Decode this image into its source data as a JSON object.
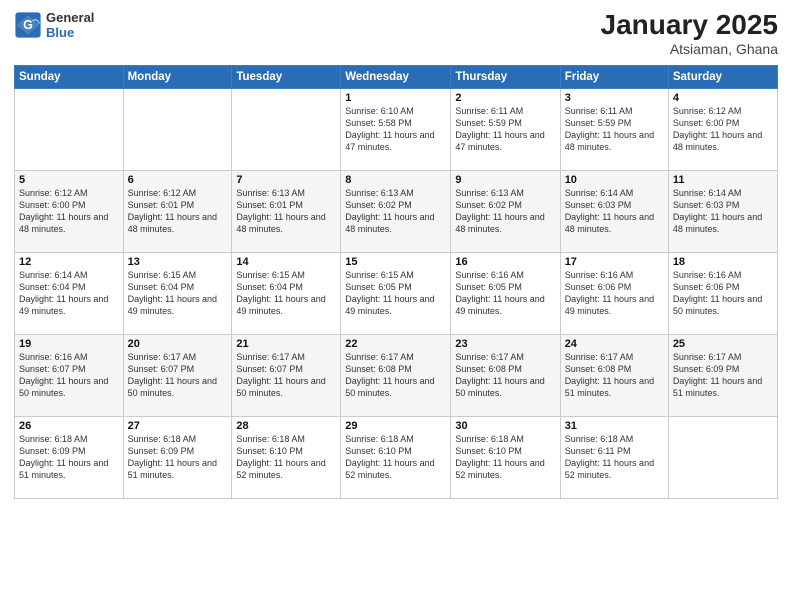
{
  "header": {
    "logo_general": "General",
    "logo_blue": "Blue",
    "month_title": "January 2025",
    "location": "Atsiaman, Ghana"
  },
  "days_of_week": [
    "Sunday",
    "Monday",
    "Tuesday",
    "Wednesday",
    "Thursday",
    "Friday",
    "Saturday"
  ],
  "weeks": [
    [
      {
        "day": "",
        "info": ""
      },
      {
        "day": "",
        "info": ""
      },
      {
        "day": "",
        "info": ""
      },
      {
        "day": "1",
        "info": "Sunrise: 6:10 AM\nSunset: 5:58 PM\nDaylight: 11 hours and 47 minutes."
      },
      {
        "day": "2",
        "info": "Sunrise: 6:11 AM\nSunset: 5:59 PM\nDaylight: 11 hours and 47 minutes."
      },
      {
        "day": "3",
        "info": "Sunrise: 6:11 AM\nSunset: 5:59 PM\nDaylight: 11 hours and 48 minutes."
      },
      {
        "day": "4",
        "info": "Sunrise: 6:12 AM\nSunset: 6:00 PM\nDaylight: 11 hours and 48 minutes."
      }
    ],
    [
      {
        "day": "5",
        "info": "Sunrise: 6:12 AM\nSunset: 6:00 PM\nDaylight: 11 hours and 48 minutes."
      },
      {
        "day": "6",
        "info": "Sunrise: 6:12 AM\nSunset: 6:01 PM\nDaylight: 11 hours and 48 minutes."
      },
      {
        "day": "7",
        "info": "Sunrise: 6:13 AM\nSunset: 6:01 PM\nDaylight: 11 hours and 48 minutes."
      },
      {
        "day": "8",
        "info": "Sunrise: 6:13 AM\nSunset: 6:02 PM\nDaylight: 11 hours and 48 minutes."
      },
      {
        "day": "9",
        "info": "Sunrise: 6:13 AM\nSunset: 6:02 PM\nDaylight: 11 hours and 48 minutes."
      },
      {
        "day": "10",
        "info": "Sunrise: 6:14 AM\nSunset: 6:03 PM\nDaylight: 11 hours and 48 minutes."
      },
      {
        "day": "11",
        "info": "Sunrise: 6:14 AM\nSunset: 6:03 PM\nDaylight: 11 hours and 48 minutes."
      }
    ],
    [
      {
        "day": "12",
        "info": "Sunrise: 6:14 AM\nSunset: 6:04 PM\nDaylight: 11 hours and 49 minutes."
      },
      {
        "day": "13",
        "info": "Sunrise: 6:15 AM\nSunset: 6:04 PM\nDaylight: 11 hours and 49 minutes."
      },
      {
        "day": "14",
        "info": "Sunrise: 6:15 AM\nSunset: 6:04 PM\nDaylight: 11 hours and 49 minutes."
      },
      {
        "day": "15",
        "info": "Sunrise: 6:15 AM\nSunset: 6:05 PM\nDaylight: 11 hours and 49 minutes."
      },
      {
        "day": "16",
        "info": "Sunrise: 6:16 AM\nSunset: 6:05 PM\nDaylight: 11 hours and 49 minutes."
      },
      {
        "day": "17",
        "info": "Sunrise: 6:16 AM\nSunset: 6:06 PM\nDaylight: 11 hours and 49 minutes."
      },
      {
        "day": "18",
        "info": "Sunrise: 6:16 AM\nSunset: 6:06 PM\nDaylight: 11 hours and 50 minutes."
      }
    ],
    [
      {
        "day": "19",
        "info": "Sunrise: 6:16 AM\nSunset: 6:07 PM\nDaylight: 11 hours and 50 minutes."
      },
      {
        "day": "20",
        "info": "Sunrise: 6:17 AM\nSunset: 6:07 PM\nDaylight: 11 hours and 50 minutes."
      },
      {
        "day": "21",
        "info": "Sunrise: 6:17 AM\nSunset: 6:07 PM\nDaylight: 11 hours and 50 minutes."
      },
      {
        "day": "22",
        "info": "Sunrise: 6:17 AM\nSunset: 6:08 PM\nDaylight: 11 hours and 50 minutes."
      },
      {
        "day": "23",
        "info": "Sunrise: 6:17 AM\nSunset: 6:08 PM\nDaylight: 11 hours and 50 minutes."
      },
      {
        "day": "24",
        "info": "Sunrise: 6:17 AM\nSunset: 6:08 PM\nDaylight: 11 hours and 51 minutes."
      },
      {
        "day": "25",
        "info": "Sunrise: 6:17 AM\nSunset: 6:09 PM\nDaylight: 11 hours and 51 minutes."
      }
    ],
    [
      {
        "day": "26",
        "info": "Sunrise: 6:18 AM\nSunset: 6:09 PM\nDaylight: 11 hours and 51 minutes."
      },
      {
        "day": "27",
        "info": "Sunrise: 6:18 AM\nSunset: 6:09 PM\nDaylight: 11 hours and 51 minutes."
      },
      {
        "day": "28",
        "info": "Sunrise: 6:18 AM\nSunset: 6:10 PM\nDaylight: 11 hours and 52 minutes."
      },
      {
        "day": "29",
        "info": "Sunrise: 6:18 AM\nSunset: 6:10 PM\nDaylight: 11 hours and 52 minutes."
      },
      {
        "day": "30",
        "info": "Sunrise: 6:18 AM\nSunset: 6:10 PM\nDaylight: 11 hours and 52 minutes."
      },
      {
        "day": "31",
        "info": "Sunrise: 6:18 AM\nSunset: 6:11 PM\nDaylight: 11 hours and 52 minutes."
      },
      {
        "day": "",
        "info": ""
      }
    ]
  ]
}
